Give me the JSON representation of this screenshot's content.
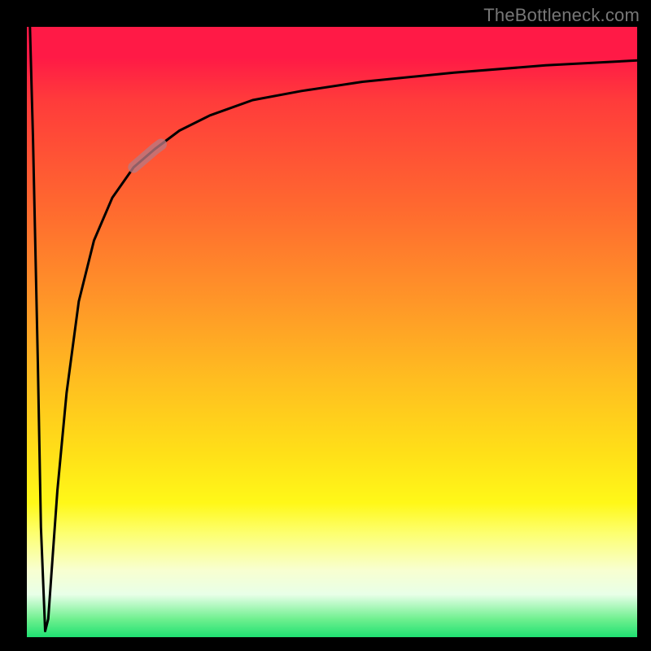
{
  "watermark": "TheBottleneck.com",
  "colors": {
    "curve": "#000000",
    "highlight": "rgba(184,120,130,0.78)"
  },
  "chart_data": {
    "type": "line",
    "title": "",
    "xlabel": "",
    "ylabel": "",
    "xlim": [
      0,
      100
    ],
    "ylim": [
      0,
      100
    ],
    "grid": false,
    "legend": false,
    "note": "Approximate bottleneck-percentage curve. x normalized 0–100, y = bottleneck % (0 = no bottleneck). Values read by eye; curve drops sharply to 0 near x≈3 then rises asymptotically toward ~95.",
    "series": [
      {
        "name": "bottleneck",
        "x": [
          0.5,
          1.0,
          1.8,
          2.3,
          3.0,
          3.5,
          4.0,
          5.0,
          6.5,
          8.5,
          11.0,
          14.0,
          17.5,
          21.0,
          25.0,
          30.0,
          37.0,
          45.0,
          55.0,
          70.0,
          85.0,
          100.0
        ],
        "values": [
          100,
          82,
          45,
          18,
          1,
          3,
          10,
          24,
          40,
          55,
          65,
          72,
          77,
          80,
          83,
          85.5,
          88,
          89.5,
          91,
          92.5,
          93.7,
          94.5
        ]
      }
    ],
    "highlight_segment": {
      "series": "bottleneck",
      "x_range": [
        17.5,
        22.0
      ],
      "note": "Thicker muted segment on the rising curve"
    }
  }
}
